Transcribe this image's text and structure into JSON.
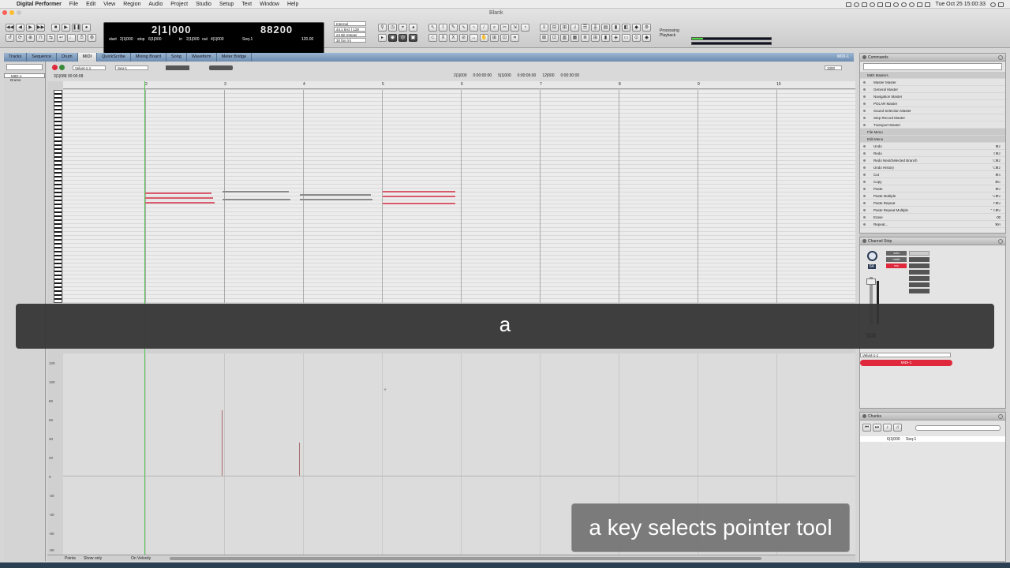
{
  "menubar": {
    "apple": "",
    "app": "Digital Performer",
    "items": [
      "File",
      "Edit",
      "View",
      "Region",
      "Audio",
      "Project",
      "Studio",
      "Setup",
      "Text",
      "Window",
      "Help"
    ],
    "clock": "Tue Oct 25  15:00:33"
  },
  "window": {
    "title": "Blank"
  },
  "counter": {
    "main": "2|1|000",
    "secondary": "88200",
    "start_label": "start",
    "start_value": "2|1|000",
    "stop_label": "stop",
    "stop_value": "6|1|000",
    "in_label": "in",
    "in_value": "2|1|000",
    "out_label": "out",
    "out_value": "4|1|000",
    "seq_label": "Seq-1",
    "tempo": "120.00"
  },
  "sync": {
    "source": "Internal",
    "rate": "44.1 kHz | 128",
    "bits": "24 Bit Integer",
    "fps": "30 fps (n)"
  },
  "status": {
    "processing": "Processing",
    "playback": "Playback",
    "meter_level": 0.14
  },
  "tabs": [
    {
      "label": "Tracks",
      "active": false
    },
    {
      "label": "Sequence",
      "active": false
    },
    {
      "label": "Drum",
      "active": false
    },
    {
      "label": "MIDI",
      "active": true
    },
    {
      "label": "QuickScribe",
      "active": false
    },
    {
      "label": "Mixing Board",
      "active": false
    },
    {
      "label": "Song",
      "active": false
    },
    {
      "label": "Waveform",
      "active": false
    },
    {
      "label": "Meter Bridge",
      "active": false
    }
  ],
  "track_selector": "MIDI-1",
  "tracklist": {
    "items": [
      "MIDI-1",
      "Drums"
    ]
  },
  "editor": {
    "track_name": "Velvet-1-1",
    "seq": "Seq-1",
    "position": "3|1|088  00:00:08",
    "zoom": "1000",
    "time_fields": [
      "2|1|000",
      "0:00:00:00",
      "5|1|000",
      "0:00:06:00",
      "12|000",
      "0:00:30:00"
    ],
    "ruler_marks": [
      "2",
      "3",
      "4",
      "5",
      "6",
      "7",
      "8",
      "9",
      "10"
    ],
    "velocity_labels": [
      "120",
      "100",
      "80",
      "60",
      "40",
      "20",
      "0",
      "-20",
      "-40",
      "-60",
      "-80"
    ],
    "footer": {
      "mode": "Points",
      "show_only": "Show only",
      "velocity": "On Velocity"
    }
  },
  "commands": {
    "title": "Commands",
    "rows": [
      {
        "label": "MIDI Masters",
        "section": true,
        "key": ""
      },
      {
        "label": "Master Master",
        "section": false,
        "key": ""
      },
      {
        "label": "General Master",
        "section": false,
        "key": ""
      },
      {
        "label": "Navigation Master",
        "section": false,
        "key": ""
      },
      {
        "label": "POLAR Master",
        "section": false,
        "key": ""
      },
      {
        "label": "Sound Selection Master",
        "section": false,
        "key": ""
      },
      {
        "label": "Step Record Master",
        "section": false,
        "key": ""
      },
      {
        "label": "Transport Master",
        "section": false,
        "key": ""
      },
      {
        "label": "File Menu",
        "section": true,
        "key": ""
      },
      {
        "label": "Edit Menu",
        "section": true,
        "key": ""
      },
      {
        "label": "Undo",
        "section": false,
        "key": "⌘Z"
      },
      {
        "label": "Redo",
        "section": false,
        "key": "⇧⌘Z"
      },
      {
        "label": "Redo Next/Selected Branch",
        "section": false,
        "key": "⌥⌘Z"
      },
      {
        "label": "Undo History",
        "section": false,
        "key": "⌥⌘Z"
      },
      {
        "label": "Cut",
        "section": false,
        "key": "⌘X"
      },
      {
        "label": "Copy",
        "section": false,
        "key": "⌘C"
      },
      {
        "label": "Paste",
        "section": false,
        "key": "⌘V"
      },
      {
        "label": "Paste Multiple",
        "section": false,
        "key": "⌥⌘V"
      },
      {
        "label": "Paste Repeat",
        "section": false,
        "key": "⇧⌘V"
      },
      {
        "label": "Paste Repeat Multiple",
        "section": false,
        "key": "⌃⇧⌘V"
      },
      {
        "label": "Erase",
        "section": false,
        "key": "⌫"
      },
      {
        "label": "Repeat...",
        "section": false,
        "key": "⌘R"
      }
    ]
  },
  "channel_strip": {
    "title": "Channel Strip",
    "pan": "64",
    "track": "Velvet-1-1",
    "output": "MIDI-1",
    "meter": "127",
    "buttons": [
      "solo",
      "mute",
      "rec"
    ]
  },
  "chunks": {
    "title": "Chunks",
    "row_position": "6|1|000",
    "row_name": "Seq-1"
  },
  "overlay": {
    "key": "a"
  },
  "caption": {
    "text": "a key selects pointer tool"
  },
  "colors": {
    "accent": "#e0283c",
    "tab_bar": "#7f9cbd",
    "playhead": "#50c850",
    "note_red": "#d95a6a",
    "note_grey": "#8a8a8a"
  }
}
